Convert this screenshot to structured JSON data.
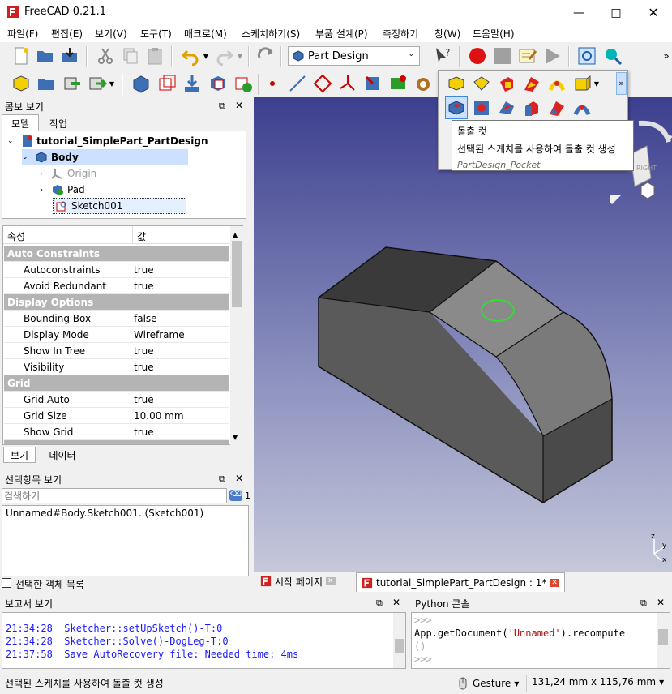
{
  "app": {
    "title": "FreeCAD 0.21.1"
  },
  "colors": {
    "accent_red": "#cc2222",
    "selection_blue": "#cce0ff",
    "viewport_top": "#3c3f8e",
    "viewport_bottom": "#c6c8da",
    "log_blue": "#1a1aff",
    "string_red": "#aa1111"
  },
  "menu": [
    "파일(F)",
    "편집(E)",
    "보기(V)",
    "도구(T)",
    "매크로(M)",
    "스케치하기(S)",
    "부품 설계(P)",
    "측정하기",
    "창(W)",
    "도움말(H)"
  ],
  "workbench": {
    "selected": "Part Design"
  },
  "combo": {
    "title": "콤보 보기",
    "tabs": [
      "모델",
      "작업"
    ],
    "tree": {
      "document": "tutorial_SimplePart_PartDesign",
      "body": "Body",
      "origin": "Origin",
      "pad": "Pad",
      "sketch": "Sketch001"
    }
  },
  "properties": {
    "header_prop": "속성",
    "header_value": "값",
    "groups": [
      {
        "name": "Auto Constraints",
        "rows": [
          {
            "k": "Autoconstraints",
            "v": "true"
          },
          {
            "k": "Avoid Redundant",
            "v": "true"
          }
        ]
      },
      {
        "name": "Display Options",
        "rows": [
          {
            "k": "Bounding Box",
            "v": "false"
          },
          {
            "k": "Display Mode",
            "v": "Wireframe"
          },
          {
            "k": "Show In Tree",
            "v": "true"
          },
          {
            "k": "Visibility",
            "v": "true"
          }
        ]
      },
      {
        "name": "Grid",
        "rows": [
          {
            "k": "Grid Auto",
            "v": "true"
          },
          {
            "k": "Grid Size",
            "v": "10.00 mm"
          },
          {
            "k": "Show Grid",
            "v": "true"
          }
        ]
      }
    ],
    "bottom_tabs": [
      "보기",
      "데이터"
    ]
  },
  "selection": {
    "title": "선택항목 보기",
    "search_placeholder": "검색하기",
    "count": "1",
    "item": "Unnamed#Body.Sketch001. (Sketch001)",
    "checkbox_label": "선택한 객체 목록"
  },
  "tooltip": {
    "title": "돌출 컷",
    "description": "선택된 스케치를 사용하여 돌출 컷 생성",
    "command": "PartDesign_Pocket"
  },
  "doc_tabs": [
    {
      "label": "시작 페이지"
    },
    {
      "label": "tutorial_SimplePart_PartDesign : 1*"
    }
  ],
  "report": {
    "title": "보고서 보기",
    "lines": [
      {
        "time": "21:34:28",
        "msg": "Sketcher::setUpSketch()-T:0"
      },
      {
        "time": "21:34:28",
        "msg": "Sketcher::Solve()-DogLeg-T:0"
      },
      {
        "time": "21:37:58",
        "msg": "Save AutoRecovery file: Needed time: 4ms"
      }
    ]
  },
  "python": {
    "title": "Python 콘솔",
    "prompt": ">>>",
    "code_pre": "App.getDocument(",
    "code_str": "'Unnamed'",
    "code_post": ").recompute",
    "code_cont": "()"
  },
  "status": {
    "message": "선택된 스케치를 사용하여 돌출 컷 생성",
    "navigation": "Gesture",
    "dimensions": "131,24 mm x 115,76 mm"
  },
  "navcube": {
    "face": "RIGHT"
  }
}
